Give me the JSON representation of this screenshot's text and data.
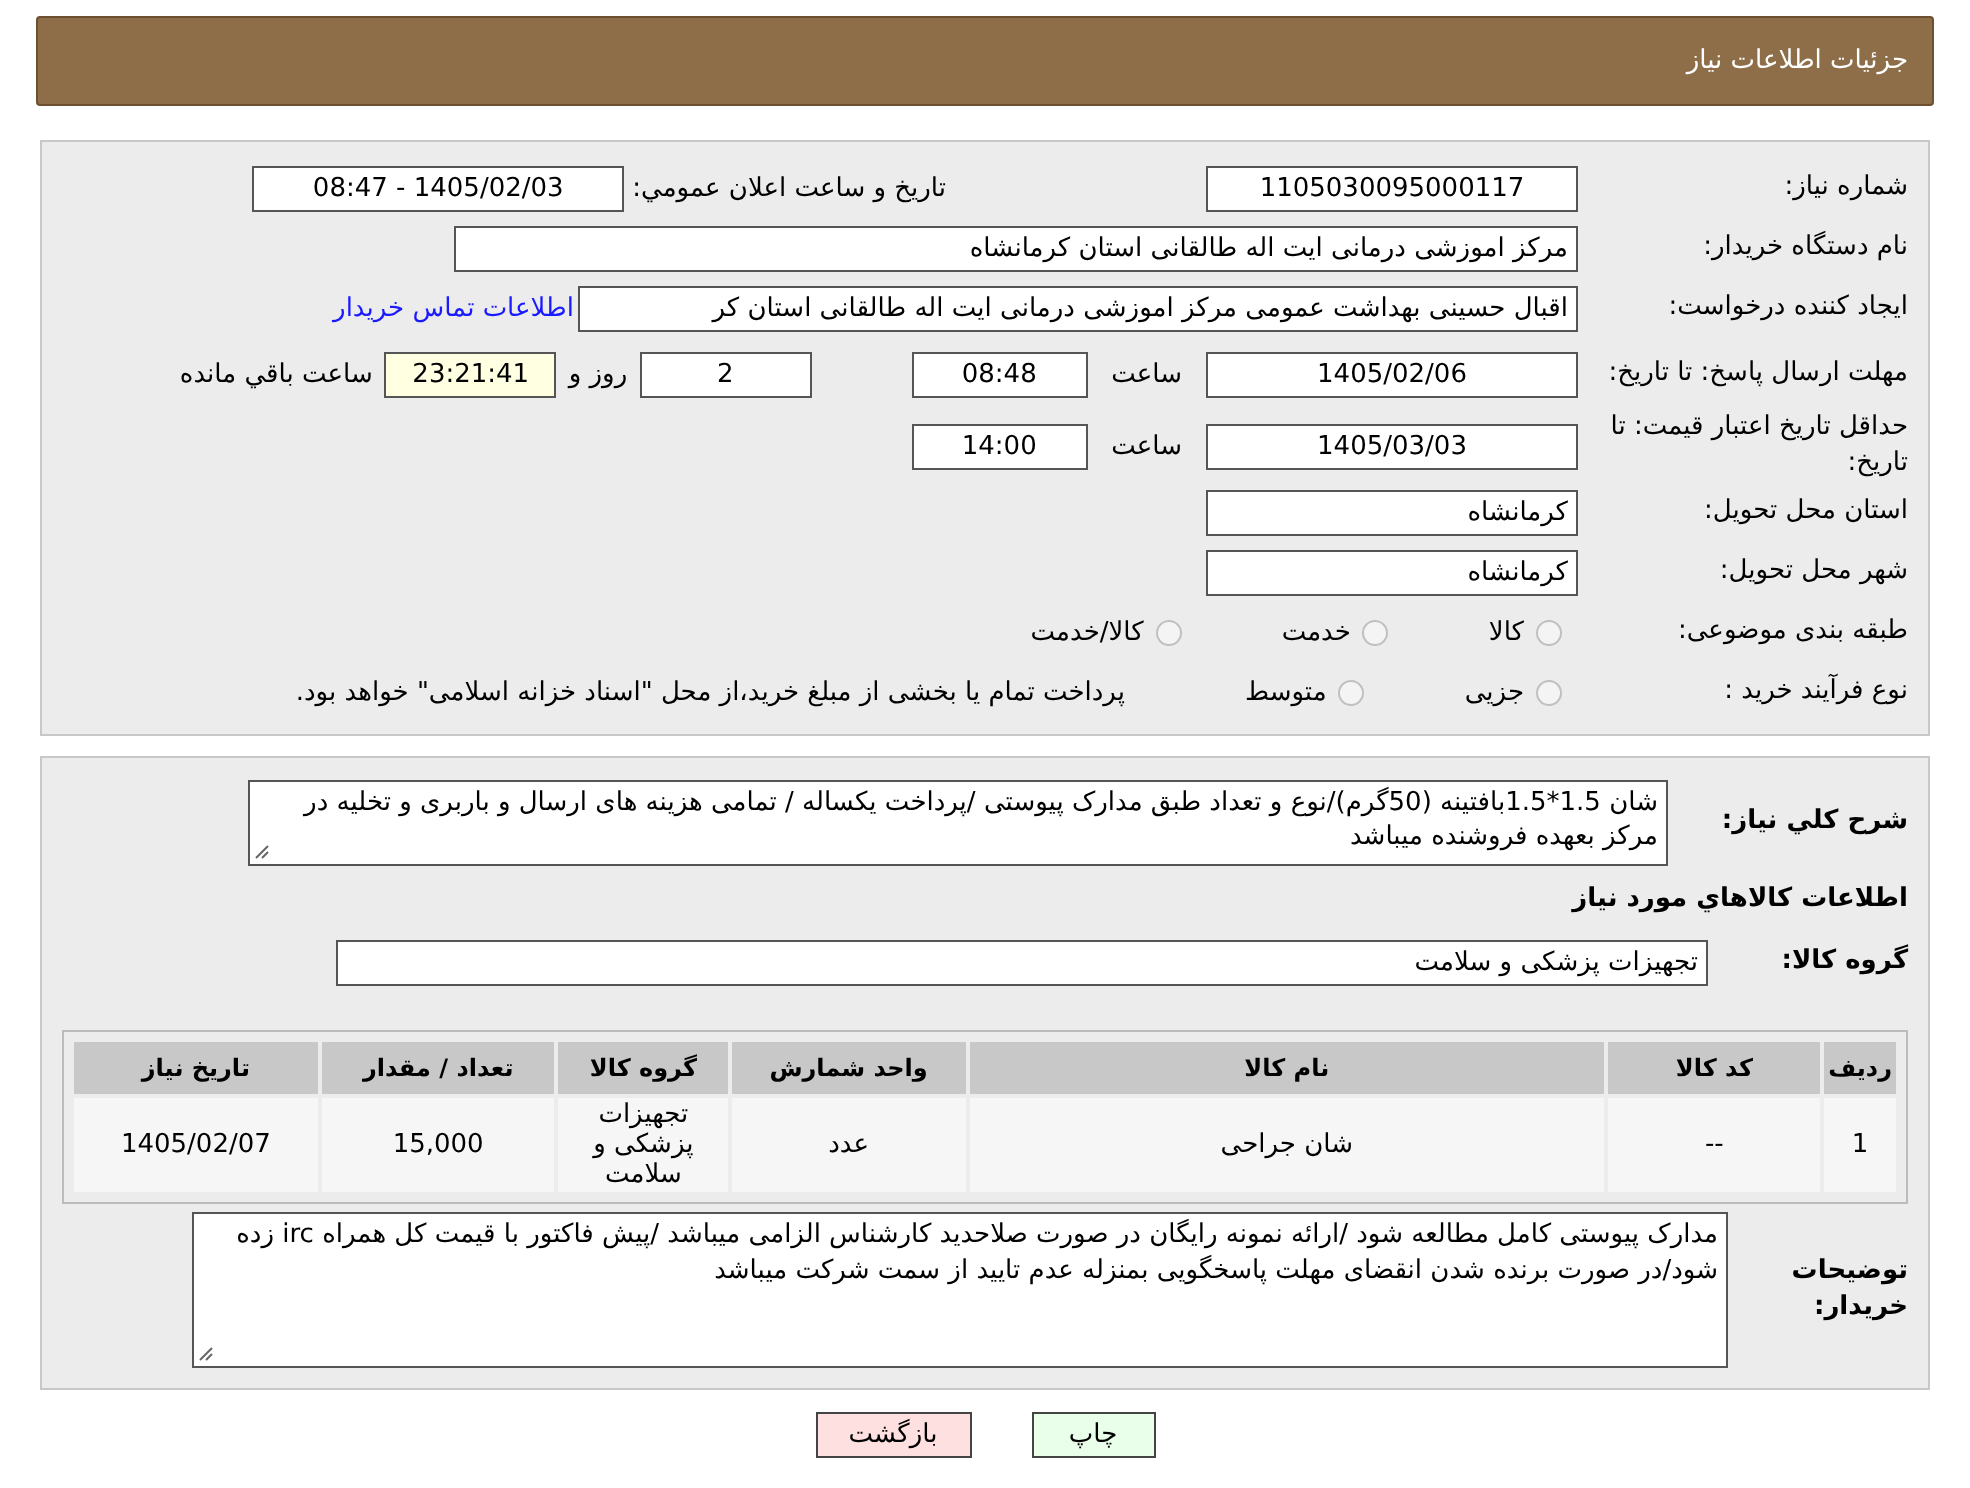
{
  "header": {
    "title": "جزئیات اطلاعات نیاز"
  },
  "details": {
    "need_number": {
      "label": "شماره نیاز:",
      "value": "1105030095000117"
    },
    "announce": {
      "label": "تاریخ و ساعت اعلان عمومي:",
      "value": "1405/02/03 - 08:47"
    },
    "buyer": {
      "label": "نام دستگاه خريدار:",
      "value": "مرکز اموزشی درمانی ایت اله طالقانی استان کرمانشاه"
    },
    "requester": {
      "label": "ايجاد کننده درخواست:",
      "value": "اقبال حسینی بهداشت عمومی مرکز اموزشی درمانی ایت اله طالقانی استان کر",
      "link": "اطلاعات تماس خریدار"
    },
    "deadline": {
      "label": "مهلت ارسال پاسخ: تا تاریخ:",
      "date": "1405/02/06",
      "time_label": "ساعت",
      "time": "08:48",
      "days": "2",
      "days_label": "روز و",
      "remaining": "23:21:41",
      "remaining_label": "ساعت باقي مانده"
    },
    "validity": {
      "label": "حداقل تاریخ اعتبار قیمت: تا تاریخ:",
      "date": "1405/03/03",
      "time_label": "ساعت",
      "time": "14:00"
    },
    "province": {
      "label": "استان محل تحويل:",
      "value": "کرمانشاه"
    },
    "city": {
      "label": "شهر محل تحويل:",
      "value": "کرمانشاه"
    },
    "category": {
      "label": "طبقه بندی موضوعی:",
      "options": [
        {
          "label": "کالا",
          "selected": false
        },
        {
          "label": "خدمت",
          "selected": false
        },
        {
          "label": "کالا/خدمت",
          "selected": false
        }
      ]
    },
    "process": {
      "label": "نوع فرآیند خرید :",
      "options": [
        {
          "label": "جزیی",
          "selected": false
        },
        {
          "label": "متوسط",
          "selected": false
        }
      ],
      "note": "پرداخت تمام یا بخشی از مبلغ خرید،از محل \"اسناد خزانه اسلامی\" خواهد بود."
    }
  },
  "summary": {
    "label": "شرح کلي نياز:",
    "text": "شان 1.5*1.5بافتینه (50گرم)/نوع و تعداد طبق مدارک پیوستی /پرداخت یکساله / تمامی هزینه های ارسال و باربری و تخلیه در مرکز بعهده فروشنده میباشد",
    "section_title": "اطلاعات كالاهاي مورد نياز",
    "group_label": "گروه کالا:",
    "group": "تجهیزات پزشکی و سلامت"
  },
  "table": {
    "columns": [
      "ردیف",
      "کد کالا",
      "نام کالا",
      "واحد شمارش",
      "گروه کالا",
      "تعداد / مقدار",
      "تاریخ نیاز"
    ],
    "rows": [
      [
        "1",
        "--",
        "شان جراحی",
        "عدد",
        "تجهیزات پزشکی و سلامت",
        "15,000",
        "1405/02/07"
      ]
    ]
  },
  "notes": {
    "label": "توضیحات خریدار:",
    "text": "مدارک پیوستی کامل مطالعه شود /ارائه نمونه رایگان در صورت صلاحدید کارشناس الزامی میباشد /پیش فاکتور با قیمت کل همراه irc  زده شود/در صورت برنده شدن انقضای مهلت پاسخگویی بمنزله عدم تایید از سمت شرکت میباشد"
  },
  "buttons": [
    {
      "label": "چاپ",
      "kind": "print"
    },
    {
      "label": "بازگشت",
      "kind": "back"
    }
  ]
}
